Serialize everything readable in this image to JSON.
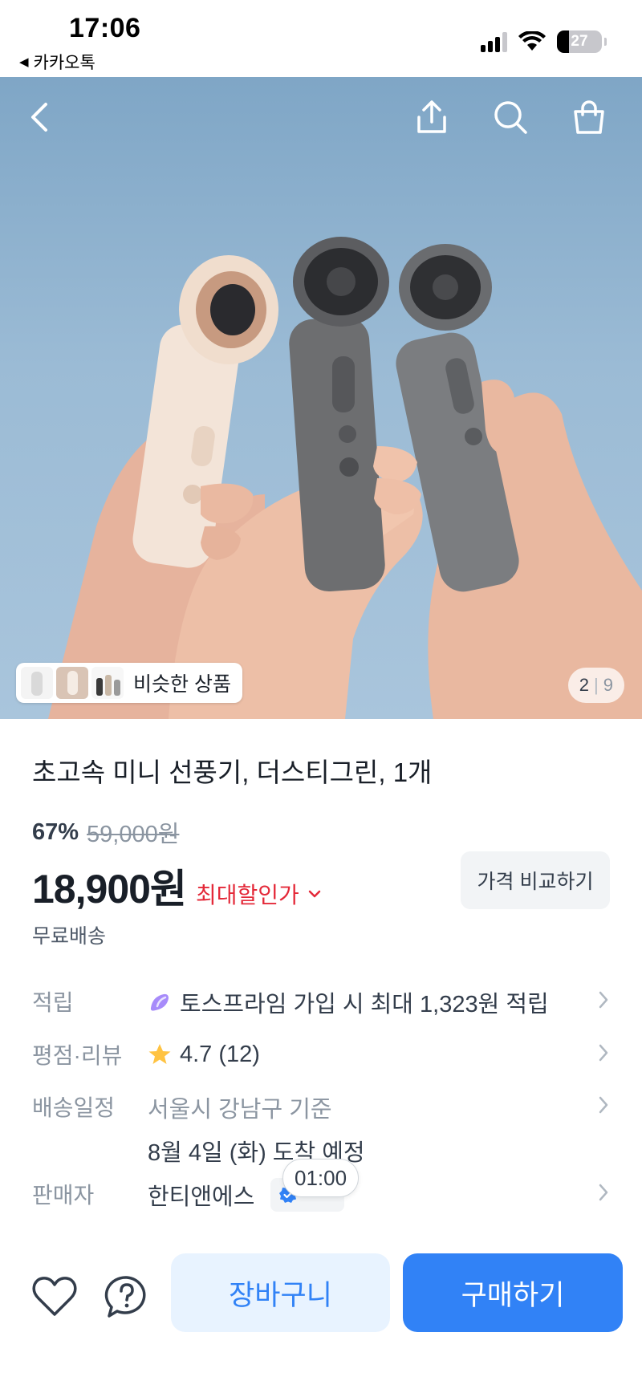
{
  "status_bar": {
    "time": "17:06",
    "back_app": "카카오톡",
    "battery": "27"
  },
  "hero": {
    "icons": [
      "back-icon",
      "share-icon",
      "search-icon",
      "shopping-bag-icon"
    ],
    "similar_label": "비슷한 상품",
    "page_current": "2",
    "page_separator": "|",
    "page_total": "9"
  },
  "product": {
    "title": "초고속 미니 선풍기, 더스티그린, 1개",
    "discount_rate": "67%",
    "original_price": "59,000원",
    "price": "18,900원",
    "max_discount_label": "최대할인가",
    "compare_label": "가격 비교하기",
    "shipping": "무료배송"
  },
  "info": {
    "points_key": "적립",
    "points_value": "토스프라임 가입 시 최대 1,323원 적립",
    "rating_key": "평점·리뷰",
    "rating_value": "4.7 (12)",
    "delivery_key": "배송일정",
    "delivery_location": "서울시 강남구 기준",
    "delivery_date": "8월 4일 (화) 도착 예정",
    "seller_key": "판매자",
    "seller_value": "한티앤에스"
  },
  "tooltip": "01:00",
  "bottom_bar": {
    "cart_label": "장바구니",
    "buy_label": "구매하기"
  },
  "colors": {
    "primary": "#3182f6",
    "primary_light": "#e8f3ff",
    "discount_red": "#e42939"
  }
}
